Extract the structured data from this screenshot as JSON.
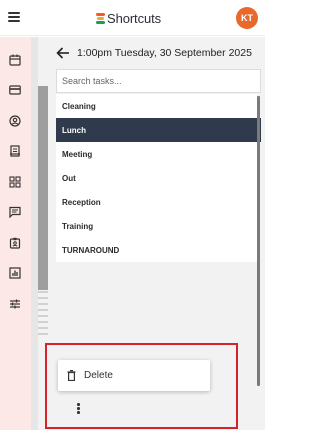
{
  "header": {
    "brand": "Shortcuts",
    "avatar_initials": "KT"
  },
  "rail": {
    "icons": [
      "calendar-icon",
      "card-icon",
      "account-circle-icon",
      "notes-icon",
      "dashboard-icon",
      "message-icon",
      "badge-icon",
      "bar-chart-icon",
      "tune-icon"
    ]
  },
  "panel": {
    "date": "1:00pm Tuesday, 30 September 2025",
    "search_placeholder": "Search tasks...",
    "tasks": [
      "Cleaning",
      "Lunch",
      "Meeting",
      "Out",
      "Reception",
      "Training",
      "TURNAROUND"
    ],
    "selected_task": "Lunch"
  },
  "menu": {
    "delete_label": "Delete"
  },
  "colors": {
    "accent": "#e8692c",
    "selected": "#2f3b4d",
    "highlight_border": "#d6232a"
  }
}
